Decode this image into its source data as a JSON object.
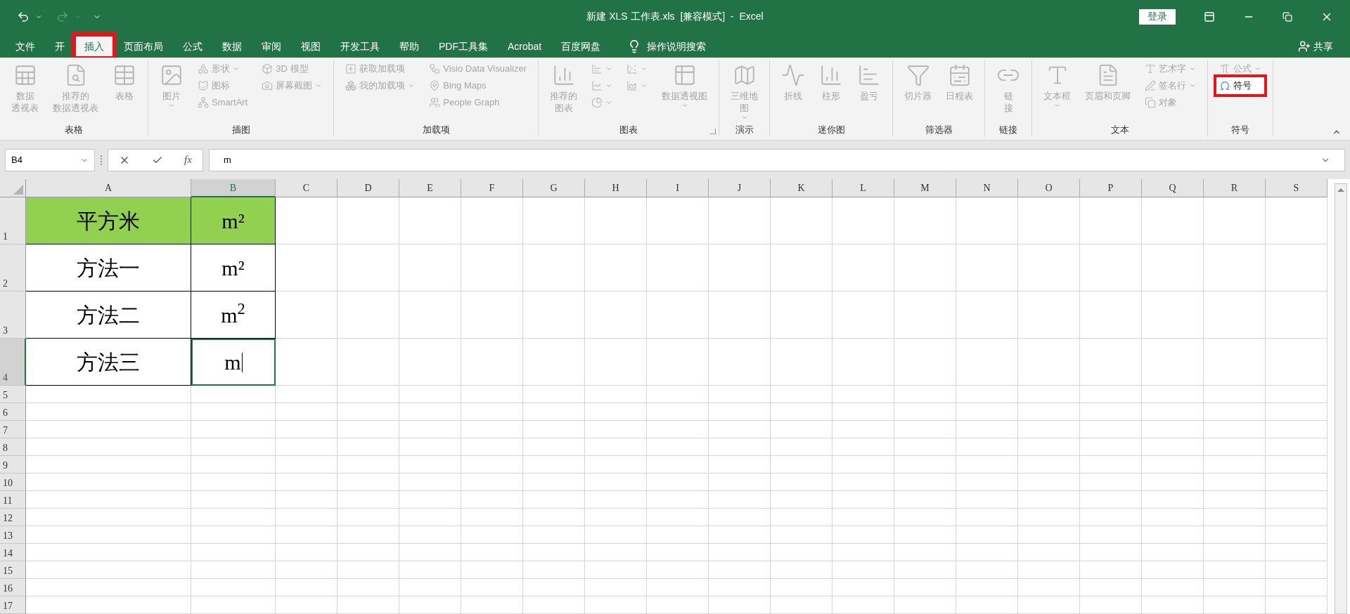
{
  "window": {
    "title": "新建 XLS 工作表.xls  [兼容模式]  -  Excel",
    "login": "登录"
  },
  "tabs": [
    {
      "label": "文件",
      "selected": false,
      "highlighted": false
    },
    {
      "label": "开",
      "selected": false,
      "highlighted": false
    },
    {
      "label": "插入",
      "selected": true,
      "highlighted": true
    },
    {
      "label": "页面布局",
      "selected": false,
      "highlighted": false
    },
    {
      "label": "公式",
      "selected": false,
      "highlighted": false
    },
    {
      "label": "数据",
      "selected": false,
      "highlighted": false
    },
    {
      "label": "审阅",
      "selected": false,
      "highlighted": false
    },
    {
      "label": "视图",
      "selected": false,
      "highlighted": false
    },
    {
      "label": "开发工具",
      "selected": false,
      "highlighted": false
    },
    {
      "label": "帮助",
      "selected": false,
      "highlighted": false
    },
    {
      "label": "PDF工具集",
      "selected": false,
      "highlighted": false
    },
    {
      "label": "Acrobat",
      "selected": false,
      "highlighted": false
    },
    {
      "label": "百度网盘",
      "selected": false,
      "highlighted": false
    }
  ],
  "tell_me": "操作说明搜索",
  "share": "共享",
  "ribbon": [
    {
      "label": "表格",
      "columns": [
        {
          "kind": "large",
          "items": [
            {
              "lines": [
                "数据",
                "透视表"
              ],
              "caret": false,
              "disabled": true
            }
          ]
        },
        {
          "kind": "large",
          "items": [
            {
              "lines": [
                "推荐的",
                "数据透视表"
              ],
              "caret": false,
              "disabled": true
            }
          ]
        },
        {
          "kind": "large",
          "items": [
            {
              "lines": [
                "表格"
              ],
              "caret": false,
              "disabled": true
            }
          ]
        }
      ]
    },
    {
      "label": "插图",
      "columns": [
        {
          "kind": "large",
          "items": [
            {
              "lines": [
                "图片"
              ],
              "caret": true,
              "disabled": true
            }
          ]
        },
        {
          "kind": "stack",
          "items": [
            {
              "lines": [
                "形状"
              ],
              "caret": true,
              "disabled": true
            },
            {
              "lines": [
                "图标"
              ],
              "caret": false,
              "disabled": true
            },
            {
              "lines": [
                "SmartArt"
              ],
              "caret": false,
              "disabled": true
            }
          ]
        },
        {
          "kind": "stack",
          "items": [
            {
              "lines": [
                "3D 模型"
              ],
              "caret": false,
              "disabled": true
            },
            {
              "lines": [
                "屏幕截图"
              ],
              "caret": true,
              "disabled": true
            }
          ]
        }
      ]
    },
    {
      "label": "加载项",
      "columns": [
        {
          "kind": "stack",
          "items": [
            {
              "lines": [
                "获取加载项"
              ],
              "caret": false,
              "disabled": true
            },
            {
              "lines": [
                "我的加载项"
              ],
              "caret": true,
              "disabled": true
            }
          ]
        },
        {
          "kind": "stack",
          "items": [
            {
              "lines": [
                "Visio Data Visualizer"
              ],
              "caret": false,
              "disabled": true
            },
            {
              "lines": [
                "Bing Maps"
              ],
              "caret": false,
              "disabled": true
            },
            {
              "lines": [
                "People Graph"
              ],
              "caret": false,
              "disabled": true
            }
          ]
        }
      ]
    },
    {
      "label": "图表",
      "launcher": true,
      "columns": [
        {
          "kind": "large",
          "items": [
            {
              "lines": [
                "推荐的",
                "图表"
              ],
              "caret": false,
              "disabled": true
            }
          ]
        },
        {
          "kind": "stack",
          "items": [
            {
              "caret": true,
              "disabled": true
            },
            {
              "caret": true,
              "disabled": true
            },
            {
              "caret": true,
              "disabled": true
            }
          ]
        },
        {
          "kind": "stack",
          "items": [
            {
              "caret": true,
              "disabled": true
            },
            {
              "caret": true,
              "disabled": true
            }
          ]
        },
        {
          "kind": "large",
          "items": [
            {
              "lines": [
                "数据透视图"
              ],
              "caret": true,
              "disabled": true
            }
          ]
        }
      ]
    },
    {
      "label": "演示",
      "columns": [
        {
          "kind": "large",
          "items": [
            {
              "lines": [
                "三维地",
                "图"
              ],
              "caret": true,
              "disabled": true
            }
          ]
        }
      ]
    },
    {
      "label": "迷你图",
      "columns": [
        {
          "kind": "large",
          "items": [
            {
              "lines": [
                "折线"
              ],
              "caret": false,
              "disabled": true
            }
          ]
        },
        {
          "kind": "large",
          "items": [
            {
              "lines": [
                "柱形"
              ],
              "caret": false,
              "disabled": true
            }
          ]
        },
        {
          "kind": "large",
          "items": [
            {
              "lines": [
                "盈亏"
              ],
              "caret": false,
              "disabled": true
            }
          ]
        }
      ]
    },
    {
      "label": "筛选器",
      "columns": [
        {
          "kind": "large",
          "items": [
            {
              "lines": [
                "切片器"
              ],
              "caret": false,
              "disabled": true
            }
          ]
        },
        {
          "kind": "large",
          "items": [
            {
              "lines": [
                "日程表"
              ],
              "caret": false,
              "disabled": true
            }
          ]
        }
      ]
    },
    {
      "label": "链接",
      "columns": [
        {
          "kind": "large",
          "items": [
            {
              "lines": [
                "链",
                "接"
              ],
              "caret": false,
              "disabled": true
            }
          ]
        }
      ]
    },
    {
      "label": "文本",
      "columns": [
        {
          "kind": "large",
          "items": [
            {
              "lines": [
                "文本框"
              ],
              "caret": true,
              "disabled": true
            }
          ]
        },
        {
          "kind": "large",
          "items": [
            {
              "lines": [
                "页眉和页脚"
              ],
              "caret": false,
              "disabled": true
            }
          ]
        },
        {
          "kind": "stack",
          "items": [
            {
              "lines": [
                "艺术字"
              ],
              "caret": true,
              "disabled": true
            },
            {
              "lines": [
                "签名行"
              ],
              "caret": true,
              "disabled": true
            },
            {
              "lines": [
                "对象"
              ],
              "caret": false,
              "disabled": true
            }
          ]
        }
      ]
    },
    {
      "label": "符号",
      "columns": [
        {
          "kind": "stack",
          "items": [
            {
              "lines": [
                "公式"
              ],
              "caret": true,
              "disabled": true,
              "highlighted": false
            },
            {
              "lines": [
                "符号"
              ],
              "caret": false,
              "disabled": false,
              "highlighted": true
            }
          ]
        }
      ]
    }
  ],
  "formula_bar": {
    "name_box": "B4",
    "function": "fx",
    "value": "m"
  },
  "columns": [
    {
      "label": "A",
      "selected": false
    },
    {
      "label": "B",
      "selected": true
    },
    {
      "label": "C",
      "selected": false
    },
    {
      "label": "D",
      "selected": false
    },
    {
      "label": "E",
      "selected": false
    },
    {
      "label": "F",
      "selected": false
    },
    {
      "label": "G",
      "selected": false
    },
    {
      "label": "H",
      "selected": false
    },
    {
      "label": "I",
      "selected": false
    },
    {
      "label": "J",
      "selected": false
    },
    {
      "label": "K",
      "selected": false
    },
    {
      "label": "L",
      "selected": false
    },
    {
      "label": "M",
      "selected": false
    },
    {
      "label": "N",
      "selected": false
    },
    {
      "label": "O",
      "selected": false
    },
    {
      "label": "P",
      "selected": false
    },
    {
      "label": "Q",
      "selected": false
    },
    {
      "label": "R",
      "selected": false
    },
    {
      "label": "S",
      "selected": false
    }
  ],
  "rows": [
    {
      "header": "1",
      "selected": false,
      "cells": [
        {
          "text": "平方米",
          "color": "#92d050",
          "selected": false,
          "editing": false
        },
        {
          "text": "m²",
          "color": "#92d050",
          "selected": false,
          "editing": false
        }
      ]
    },
    {
      "header": "2",
      "selected": false,
      "cells": [
        {
          "text": "方法一",
          "selected": false,
          "editing": false
        },
        {
          "text": "m²",
          "selected": false,
          "editing": false
        }
      ]
    },
    {
      "header": "3",
      "selected": false,
      "cells": [
        {
          "text": "方法二",
          "selected": false,
          "editing": false
        },
        {
          "text": "m$^{2}$",
          "selected": false,
          "editing": false
        }
      ]
    },
    {
      "header": "4",
      "selected": true,
      "cells": [
        {
          "text": "方法三",
          "selected": false,
          "editing": false
        },
        {
          "text": "m",
          "selected": true,
          "editing": true
        }
      ]
    },
    {
      "header": "5",
      "selected": false,
      "cells": []
    },
    {
      "header": "6",
      "selected": false,
      "cells": []
    },
    {
      "header": "7",
      "selected": false,
      "cells": []
    },
    {
      "header": "8",
      "selected": false,
      "cells": []
    },
    {
      "header": "9",
      "selected": false,
      "cells": []
    },
    {
      "header": "10",
      "selected": false,
      "cells": []
    },
    {
      "header": "11",
      "selected": false,
      "cells": []
    },
    {
      "header": "12",
      "selected": false,
      "cells": []
    },
    {
      "header": "13",
      "selected": false,
      "cells": []
    },
    {
      "header": "14",
      "selected": false,
      "cells": []
    },
    {
      "header": "15",
      "selected": false,
      "cells": []
    },
    {
      "header": "16",
      "selected": false,
      "cells": []
    },
    {
      "header": "17",
      "selected": false,
      "cells": []
    }
  ]
}
